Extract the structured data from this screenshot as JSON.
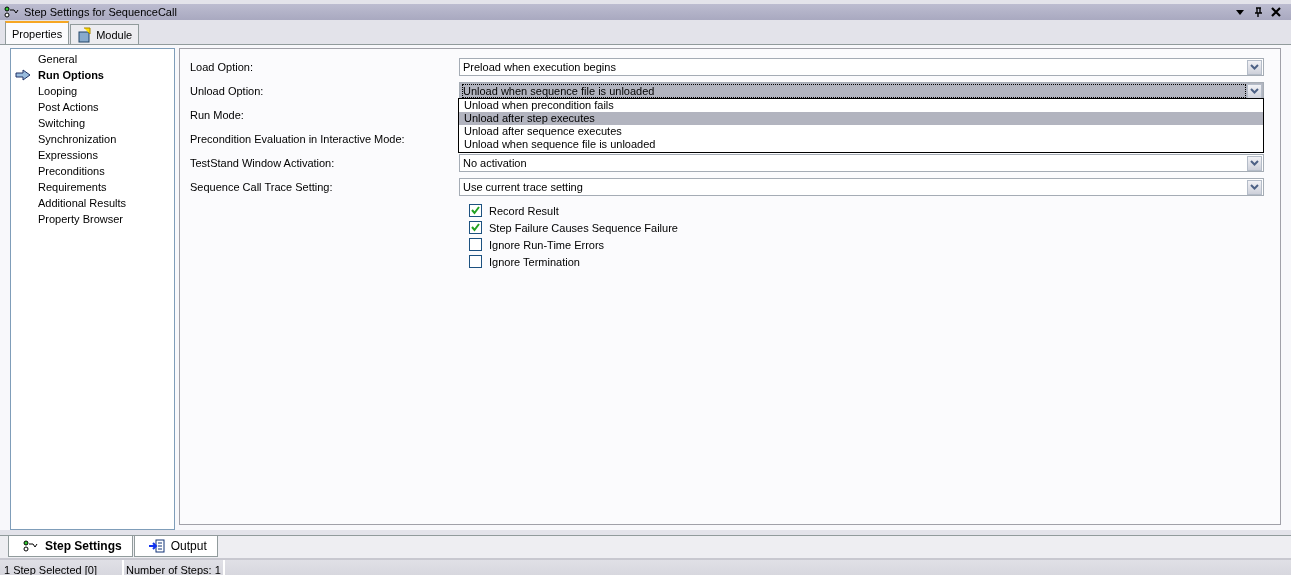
{
  "window": {
    "title": "Step Settings for SequenceCall"
  },
  "tabs": [
    {
      "label": "Properties",
      "selected": true
    },
    {
      "label": "Module",
      "selected": false
    }
  ],
  "sidebar": {
    "items": [
      {
        "label": "General",
        "selected": false
      },
      {
        "label": "Run Options",
        "selected": true
      },
      {
        "label": "Looping",
        "selected": false
      },
      {
        "label": "Post Actions",
        "selected": false
      },
      {
        "label": "Switching",
        "selected": false
      },
      {
        "label": "Synchronization",
        "selected": false
      },
      {
        "label": "Expressions",
        "selected": false
      },
      {
        "label": "Preconditions",
        "selected": false
      },
      {
        "label": "Requirements",
        "selected": false
      },
      {
        "label": "Additional Results",
        "selected": false
      },
      {
        "label": "Property Browser",
        "selected": false
      }
    ]
  },
  "fields": [
    {
      "label": "Load Option:",
      "value": "Preload when execution begins",
      "focused": false
    },
    {
      "label": "Unload Option:",
      "value": "Unload when sequence file is unloaded",
      "focused": true,
      "open": true,
      "options": [
        {
          "label": "Unload when precondition fails",
          "highlighted": false
        },
        {
          "label": "Unload after step executes",
          "highlighted": true
        },
        {
          "label": "Unload after sequence executes",
          "highlighted": false
        },
        {
          "label": "Unload when sequence file is unloaded",
          "highlighted": false
        }
      ]
    },
    {
      "label": "Run Mode:"
    },
    {
      "label": "Precondition Evaluation in Interactive Mode:"
    },
    {
      "label": "TestStand Window Activation:",
      "value": "No activation",
      "focused": false
    },
    {
      "label": "Sequence Call Trace Setting:",
      "value": "Use current trace setting",
      "focused": false
    }
  ],
  "checkboxes": [
    {
      "label": "Record Result",
      "checked": true
    },
    {
      "label": "Step Failure Causes Sequence Failure",
      "checked": true
    },
    {
      "label": "Ignore Run-Time Errors",
      "checked": false
    },
    {
      "label": "Ignore Termination",
      "checked": false
    }
  ],
  "bottom_tabs": [
    {
      "label": "Step Settings",
      "selected": true
    },
    {
      "label": "Output",
      "selected": false
    }
  ],
  "status_bar": [
    "1 Step Selected [0]",
    "Number of Steps: 1"
  ]
}
